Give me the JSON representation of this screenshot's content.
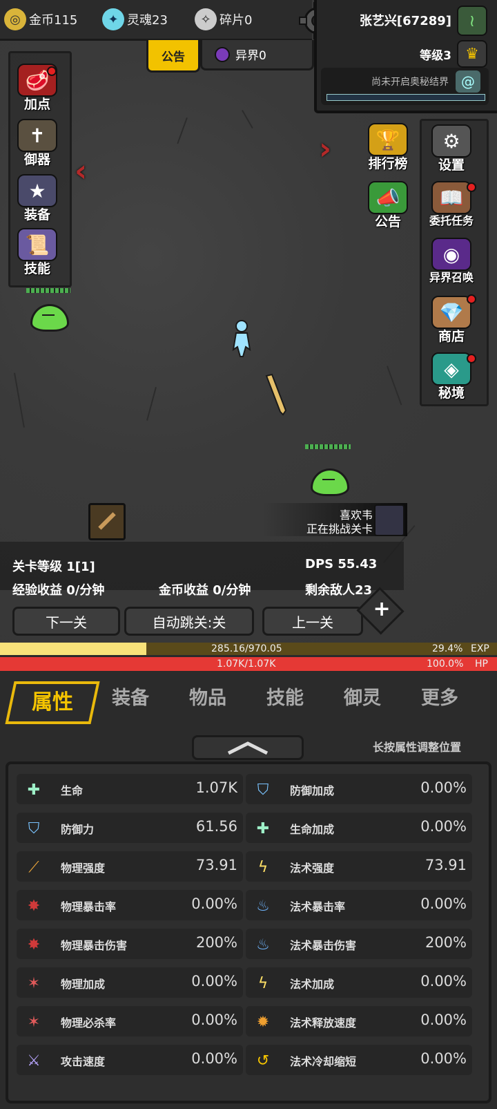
{
  "resources": {
    "gold": "金币115",
    "soul": "灵魂23",
    "shard": "碎片0"
  },
  "player": {
    "name": "张艺兴[67289]",
    "level": "等级3",
    "secret_realm": "尚未开启奥秘结界"
  },
  "top_tabs": {
    "notice": "公告",
    "other_world": "异界0"
  },
  "left_menu": [
    {
      "label": "加点",
      "icon": "meat-icon"
    },
    {
      "label": "御器",
      "icon": "sword-cross-icon"
    },
    {
      "label": "装备",
      "icon": "shield-star-icon"
    },
    {
      "label": "技能",
      "icon": "scroll-icon"
    }
  ],
  "center_menu": [
    {
      "label": "排行榜",
      "icon": "trophy-icon"
    },
    {
      "label": "公告",
      "icon": "megaphone-icon"
    }
  ],
  "right_menu": [
    {
      "label": "设置",
      "icon": "gear-icon"
    },
    {
      "label": "委托任务",
      "icon": "book-icon"
    },
    {
      "label": "异界召唤",
      "icon": "portal-icon"
    },
    {
      "label": "商店",
      "icon": "shop-icon"
    },
    {
      "label": "秘境",
      "icon": "secret-icon"
    }
  ],
  "challenger": {
    "name": "喜欢韦",
    "action": "正在挑战关卡"
  },
  "stage": {
    "level": "关卡等级 1[1]",
    "dps": "DPS 55.43",
    "exp_rate": "经验收益 0/分钟",
    "gold_rate": "金币收益 0/分钟",
    "enemies": "剩余敌人23"
  },
  "buttons": {
    "next": "下一关",
    "auto": "自动跳关:关",
    "prev": "上一关"
  },
  "exp": {
    "text": "285.16/970.05",
    "percent": "29.4%",
    "label": "EXP",
    "fraction": 0.294
  },
  "hp": {
    "text": "1.07K/1.07K",
    "percent": "100.0%",
    "label": "HP",
    "fraction": 1.0
  },
  "tabs": [
    "属性",
    "装备",
    "物品",
    "技能",
    "御灵",
    "更多"
  ],
  "hint": "长按属性调整位置",
  "attributes_left": [
    {
      "name": "生命",
      "value": "1.07K",
      "icon": "life-plus-icon"
    },
    {
      "name": "防御力",
      "value": "61.56",
      "icon": "shield-icon"
    },
    {
      "name": "物理强度",
      "value": "73.91",
      "icon": "blade-icon"
    },
    {
      "name": "物理暴击率",
      "value": "0.00%",
      "icon": "red-claw-icon"
    },
    {
      "name": "物理暴击伤害",
      "value": "200%",
      "icon": "red-claw-icon"
    },
    {
      "name": "物理加成",
      "value": "0.00%",
      "icon": "red-burst-icon"
    },
    {
      "name": "物理必杀率",
      "value": "0.00%",
      "icon": "red-burst-icon"
    },
    {
      "name": "攻击速度",
      "value": "0.00%",
      "icon": "swords-icon"
    }
  ],
  "attributes_right": [
    {
      "name": "防御加成",
      "value": "0.00%",
      "icon": "shield-icon"
    },
    {
      "name": "生命加成",
      "value": "0.00%",
      "icon": "life-plus-icon"
    },
    {
      "name": "法术强度",
      "value": "73.91",
      "icon": "lightning-icon"
    },
    {
      "name": "法术暴击率",
      "value": "0.00%",
      "icon": "blue-flame-icon"
    },
    {
      "name": "法术暴击伤害",
      "value": "200%",
      "icon": "blue-flame-icon"
    },
    {
      "name": "法术加成",
      "value": "0.00%",
      "icon": "lightning-icon"
    },
    {
      "name": "法术释放速度",
      "value": "0.00%",
      "icon": "fire-ring-icon"
    },
    {
      "name": "法术冷却缩短",
      "value": "0.00%",
      "icon": "cooldown-icon"
    }
  ]
}
